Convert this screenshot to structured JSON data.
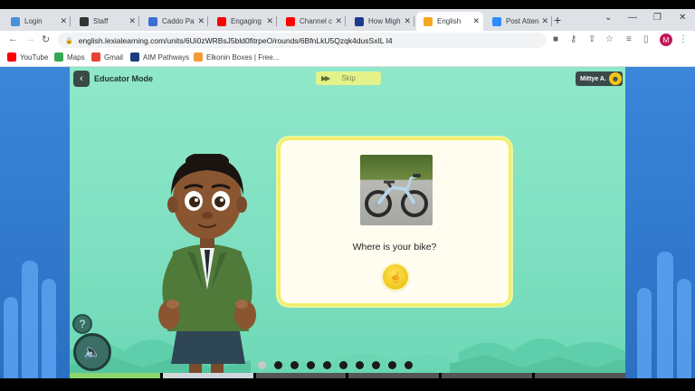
{
  "browser": {
    "tabs": [
      {
        "label": "Login",
        "icon": "login-favicon",
        "color": "#4a90d9"
      },
      {
        "label": "Staff",
        "icon": "staff-favicon",
        "color": "#333333"
      },
      {
        "label": "Caddo Pa",
        "icon": "caddo-favicon",
        "color": "#3a6fd8"
      },
      {
        "label": "Engaging F",
        "icon": "youtube-favicon",
        "color": "#ff0000"
      },
      {
        "label": "Channel co",
        "icon": "youtube-favicon",
        "color": "#ff0000"
      },
      {
        "label": "How Migh",
        "icon": "video-favicon",
        "color": "#1e3a8a"
      },
      {
        "label": "English",
        "icon": "lexia-favicon",
        "color": "#f5a623"
      },
      {
        "label": "Post Atten",
        "icon": "zoom-favicon",
        "color": "#2d8cff"
      }
    ],
    "active_tab": 6,
    "url": "english.lexialearning.com/units/6Ui0zWRBsJ5bld0fitrpeO/rounds/6BfnLkU5Qzqk4dusSxIL I4",
    "profile_initial": "M",
    "bookmarks": [
      {
        "label": "YouTube",
        "color": "#ff0000"
      },
      {
        "label": "Maps",
        "color": "#34a853"
      },
      {
        "label": "Gmail",
        "color": "#ea4335"
      },
      {
        "label": "AIM Pathways",
        "color": "#1a3d7c"
      },
      {
        "label": "Elkonin Boxes | Free...",
        "color": "#f29b38"
      }
    ]
  },
  "app": {
    "mode_title": "Educator Mode",
    "skip_label": "Skip",
    "user_name": "Mittye A.",
    "prompt_text": "Where is your bike?",
    "progress": {
      "total": 10,
      "completed": 1
    },
    "bottom_segments": {
      "total": 6,
      "filled": 1,
      "current": 2
    },
    "colors": {
      "stage": "#7fe0c1",
      "card_border": "#f2ef6a",
      "skip_bg": "#e4f28a",
      "audio_button": "#f5c518"
    }
  }
}
